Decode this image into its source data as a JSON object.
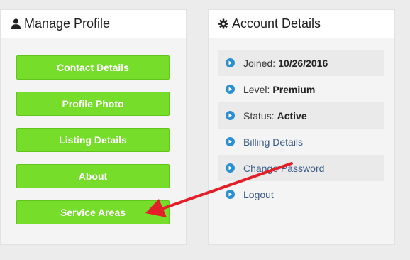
{
  "manage_profile": {
    "title": "Manage Profile",
    "icon": "user-icon",
    "buttons": [
      {
        "label": "Contact Details"
      },
      {
        "label": "Profile Photo"
      },
      {
        "label": "Listing Details"
      },
      {
        "label": "About"
      },
      {
        "label": "Service Areas"
      }
    ],
    "button_color": "#76dd2a"
  },
  "account_details": {
    "title": "Account Details",
    "icon": "gear-icon",
    "joined": {
      "label": "Joined:",
      "value": "10/26/2016"
    },
    "level": {
      "label": "Level:",
      "value": "Premium"
    },
    "status": {
      "label": "Status:",
      "value": "Active"
    },
    "links": {
      "billing": "Billing Details",
      "password": "Change Password",
      "logout": "Logout"
    },
    "bullet_icon": "play-circle-icon",
    "bullet_color": "#2a8fd4"
  },
  "annotation": {
    "icon": "red-arrow-annotation",
    "color": "#e3202a"
  }
}
